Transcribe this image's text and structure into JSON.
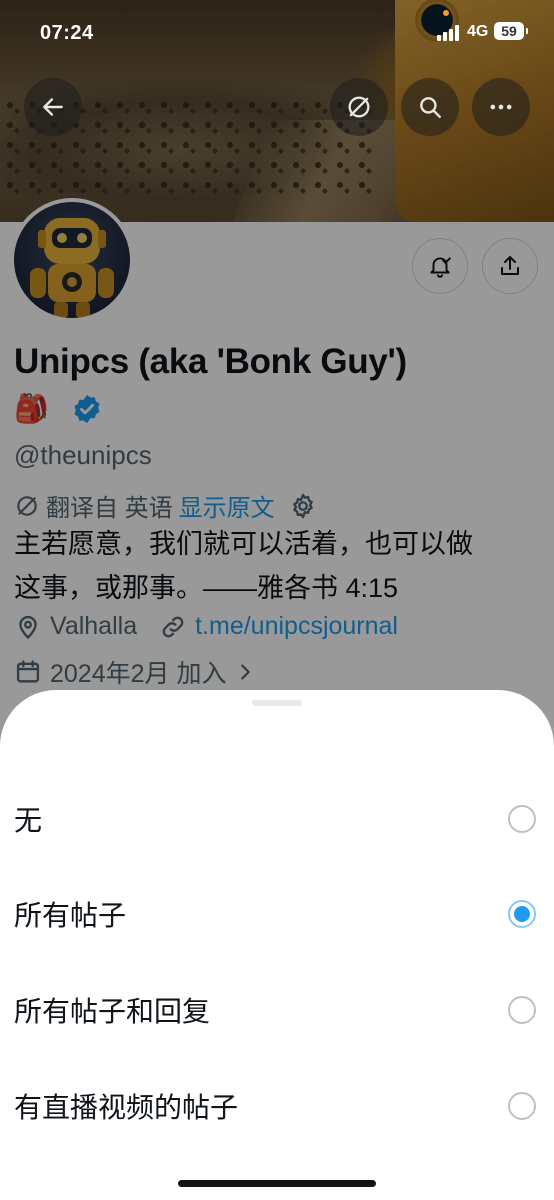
{
  "status_bar": {
    "time": "07:24",
    "network": "4G",
    "battery": "59"
  },
  "header": {
    "back_icon": "arrow-left-icon",
    "translate_icon": "translate-off-icon",
    "search_icon": "search-icon",
    "more_icon": "more-horizontal-icon"
  },
  "profile": {
    "name": "Unipcs (aka 'Bonk Guy')",
    "emoji": "🎒",
    "handle": "@theunipcs",
    "translate": {
      "prefix": "翻译自 英语",
      "show_original": "显示原文"
    },
    "bio_line1": "主若愿意，我们就可以活着，也可以做",
    "bio_line2": "这事，或那事。——雅各书 4:15",
    "location": "Valhalla",
    "link": "t.me/unipcsjournal",
    "joined": "2024年2月 加入",
    "accent_color": "#1d9bf0"
  },
  "sheet": {
    "options": [
      {
        "label": "无",
        "selected": false
      },
      {
        "label": "所有帖子",
        "selected": true
      },
      {
        "label": "所有帖子和回复",
        "selected": false
      },
      {
        "label": "有直播视频的帖子",
        "selected": false
      }
    ]
  }
}
